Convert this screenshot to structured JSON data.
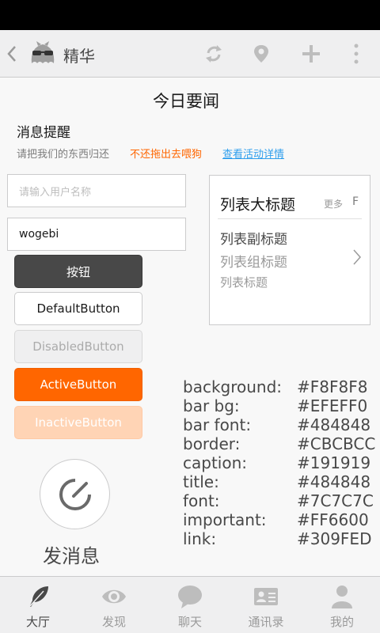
{
  "header": {
    "title": "精华",
    "back_icon": "chevron-left-icon",
    "avatar_icon": "ghost-sunglasses-icon",
    "actions": [
      "refresh-icon",
      "location-icon",
      "add-icon",
      "more-vertical-icon"
    ]
  },
  "page": {
    "heading": "今日要闻"
  },
  "notice": {
    "title": "消息提醒",
    "text": "请把我们的东西归还",
    "important": "不还拖出去喂狗",
    "link": "查看活动详情"
  },
  "form": {
    "username_placeholder": "请输入用户名称",
    "second_value": "wogebi"
  },
  "buttons": {
    "primary": "按钮",
    "default": "DefaultButton",
    "disabled": "DisabledButton",
    "active": "ActiveButton",
    "inactive": "InactiveButton"
  },
  "list_card": {
    "big_title": "列表大标题",
    "more": "更多",
    "more_letter": "F",
    "sub_title": "列表副标题",
    "group_title": "列表组标题",
    "item_title": "列表标题"
  },
  "compose": {
    "label": "发消息"
  },
  "color_table": [
    {
      "key": "background:",
      "value": "#F8F8F8"
    },
    {
      "key": "bar bg:",
      "value": "#EFEFF0"
    },
    {
      "key": "bar font:",
      "value": "#484848"
    },
    {
      "key": "border:",
      "value": "#CBCBCC"
    },
    {
      "key": "caption:",
      "value": "#191919"
    },
    {
      "key": "title:",
      "value": "#484848"
    },
    {
      "key": "font:",
      "value": "#7C7C7C"
    },
    {
      "key": "important:",
      "value": "#FF6600"
    },
    {
      "key": "link:",
      "value": "#309FED"
    }
  ],
  "tabs": [
    {
      "label": "大厅",
      "icon": "feather-icon",
      "active": true
    },
    {
      "label": "发现",
      "icon": "eye-icon",
      "active": false
    },
    {
      "label": "聊天",
      "icon": "chat-bubble-icon",
      "active": false
    },
    {
      "label": "通讯录",
      "icon": "contact-card-icon",
      "active": false
    },
    {
      "label": "我的",
      "icon": "user-icon",
      "active": false
    }
  ],
  "colors": {
    "accent": "#FF6600",
    "link": "#309FED",
    "bar_bg": "#EFEFF0",
    "border": "#CBCBCC"
  }
}
